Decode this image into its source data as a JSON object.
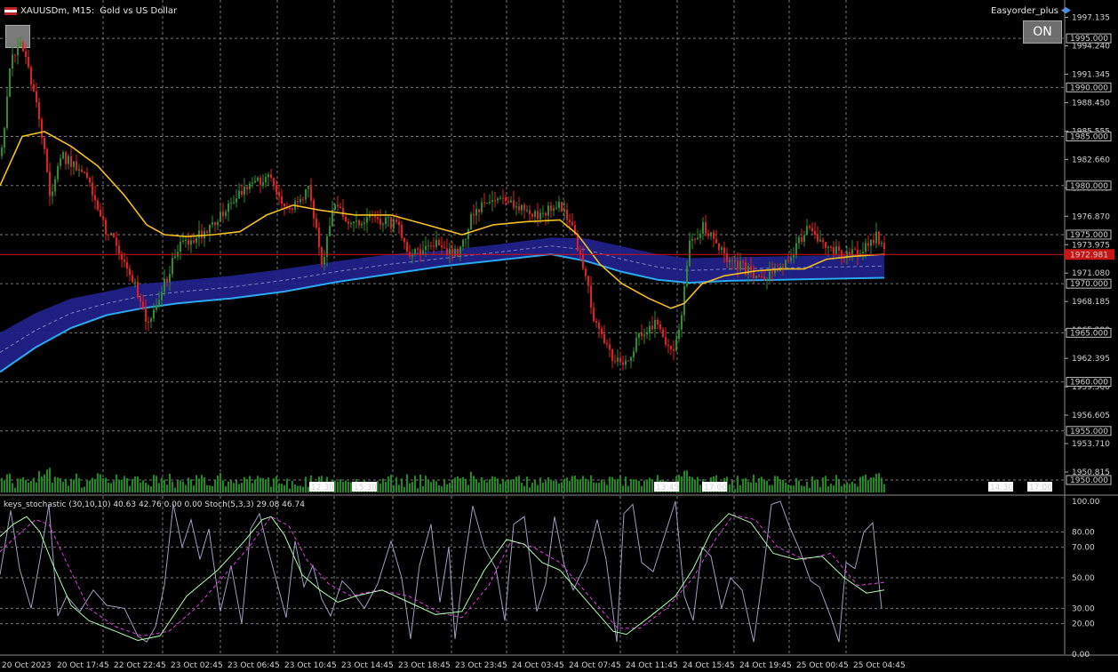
{
  "header": {
    "symbol": "XAUUSDm, M15:",
    "description": "Gold vs US Dollar"
  },
  "expert": {
    "name": "Easyorder_plus"
  },
  "buttons": {
    "on_label": "ON"
  },
  "indicator": {
    "label": "keys_stochastic (30,10,10) 40.63 42.76 0.00 0.00 Stoch(5,3,3) 29.08 46.74"
  },
  "colors": {
    "bull": "#2e8b2e",
    "bear": "#e31e1e",
    "ema_line": "#f2c01e",
    "band_fill": "#222290",
    "band_edge": "#2aa8f2",
    "hline": "#c81414",
    "grid": "#777777",
    "stoch_main": "#b0ffb0",
    "stoch_signal": "#e040e0",
    "stoch_fast": "#9aa0c0"
  },
  "chart_data": {
    "type": "candlestick",
    "title": "XAUUSDm, M15: Gold vs US Dollar",
    "price_axis": {
      "ylim": [
        1950.0,
        1998.0
      ],
      "tick_labels": [
        "1997.135",
        "1994.240",
        "1991.345",
        "1988.450",
        "1985.555",
        "1982.660",
        "1979.765",
        "1976.870",
        "1973.975",
        "1971.080",
        "1968.185",
        "1965.290",
        "1962.395",
        "1959.500",
        "1956.605",
        "1953.710",
        "1950.815"
      ],
      "boxed_levels": [
        "1995.000",
        "1990.000",
        "1985.000",
        "1980.000",
        "1975.000",
        "1970.000",
        "1965.000",
        "1960.000",
        "1955.000",
        "1950.000"
      ],
      "current_price": "1972.981"
    },
    "stochastic_axis": {
      "ylim": [
        0,
        100
      ],
      "tick_labels": [
        "100.00",
        "80.00",
        "70.00",
        "50.00",
        "30.00",
        "20.00",
        "0.00"
      ]
    },
    "time_labels": [
      "20 Oct 2023",
      "20 Oct 17:45",
      "22 Oct 22:45",
      "23 Oct 02:45",
      "23 Oct 06:45",
      "23 Oct 10:45",
      "23 Oct 14:45",
      "23 Oct 18:45",
      "23 Oct 23:45",
      "24 Oct 03:45",
      "24 Oct 07:45",
      "24 Oct 11:45",
      "24 Oct 15:45",
      "24 Oct 19:45",
      "25 Oct 00:45",
      "25 Oct 04:45"
    ],
    "time_tags": [
      "12:30",
      "15:30",
      "13:45",
      "17:00",
      "14:30",
      "17:00"
    ],
    "close_path": [
      [
        0,
        1983
      ],
      [
        12,
        1993
      ],
      [
        22,
        1995
      ],
      [
        30,
        1992
      ],
      [
        45,
        1986
      ],
      [
        55,
        1979
      ],
      [
        70,
        1983
      ],
      [
        95,
        1981
      ],
      [
        115,
        1976
      ],
      [
        135,
        1973
      ],
      [
        150,
        1970
      ],
      [
        165,
        1966
      ],
      [
        180,
        1969
      ],
      [
        200,
        1974
      ],
      [
        225,
        1975
      ],
      [
        250,
        1977
      ],
      [
        275,
        1980
      ],
      [
        300,
        1981
      ],
      [
        315,
        1978
      ],
      [
        335,
        1978
      ],
      [
        345,
        1980
      ],
      [
        362,
        1972
      ],
      [
        375,
        1978
      ],
      [
        395,
        1976
      ],
      [
        415,
        1977
      ],
      [
        445,
        1976
      ],
      [
        460,
        1973
      ],
      [
        490,
        1974
      ],
      [
        515,
        1973
      ],
      [
        530,
        1977
      ],
      [
        555,
        1979
      ],
      [
        575,
        1978
      ],
      [
        600,
        1977
      ],
      [
        630,
        1978
      ],
      [
        645,
        1975
      ],
      [
        655,
        1972
      ],
      [
        668,
        1966
      ],
      [
        690,
        1962
      ],
      [
        705,
        1962
      ],
      [
        718,
        1965
      ],
      [
        735,
        1966
      ],
      [
        755,
        1963
      ],
      [
        765,
        1966
      ],
      [
        775,
        1974
      ],
      [
        790,
        1976
      ],
      [
        805,
        1974
      ],
      [
        825,
        1972
      ],
      [
        850,
        1971
      ],
      [
        875,
        1971
      ],
      [
        890,
        1973
      ],
      [
        910,
        1976
      ],
      [
        925,
        1974
      ],
      [
        945,
        1973
      ],
      [
        965,
        1973
      ],
      [
        985,
        1975
      ],
      [
        995,
        1973
      ]
    ],
    "ema_path": [
      [
        0,
        1980
      ],
      [
        25,
        1985
      ],
      [
        50,
        1985.5
      ],
      [
        80,
        1984
      ],
      [
        110,
        1982
      ],
      [
        140,
        1979
      ],
      [
        165,
        1976
      ],
      [
        185,
        1975
      ],
      [
        210,
        1974.8
      ],
      [
        240,
        1975
      ],
      [
        270,
        1975.3
      ],
      [
        300,
        1977
      ],
      [
        330,
        1978
      ],
      [
        360,
        1977.5
      ],
      [
        400,
        1977
      ],
      [
        440,
        1977
      ],
      [
        480,
        1976
      ],
      [
        520,
        1975
      ],
      [
        555,
        1976
      ],
      [
        590,
        1976.3
      ],
      [
        630,
        1976.5
      ],
      [
        650,
        1975
      ],
      [
        675,
        1972
      ],
      [
        700,
        1970
      ],
      [
        730,
        1968.5
      ],
      [
        755,
        1967.5
      ],
      [
        770,
        1968
      ],
      [
        790,
        1970
      ],
      [
        815,
        1970.8
      ],
      [
        850,
        1971.3
      ],
      [
        880,
        1971.5
      ],
      [
        905,
        1971.5
      ],
      [
        930,
        1972.5
      ],
      [
        960,
        1972.8
      ],
      [
        995,
        1973
      ]
    ],
    "band_upper": [
      [
        0,
        1965
      ],
      [
        40,
        1967
      ],
      [
        80,
        1968.5
      ],
      [
        120,
        1969.2
      ],
      [
        160,
        1970
      ],
      [
        200,
        1970.3
      ],
      [
        260,
        1970.8
      ],
      [
        320,
        1971.5
      ],
      [
        380,
        1972.3
      ],
      [
        440,
        1973
      ],
      [
        500,
        1973.4
      ],
      [
        560,
        1974
      ],
      [
        620,
        1974.7
      ],
      [
        660,
        1974.6
      ],
      [
        700,
        1973.8
      ],
      [
        740,
        1973
      ],
      [
        775,
        1972.6
      ],
      [
        820,
        1972.7
      ],
      [
        880,
        1972.8
      ],
      [
        995,
        1973
      ]
    ],
    "band_lower": [
      [
        0,
        1961
      ],
      [
        40,
        1963.5
      ],
      [
        80,
        1965.5
      ],
      [
        120,
        1966.8
      ],
      [
        160,
        1967.5
      ],
      [
        200,
        1968
      ],
      [
        260,
        1968.5
      ],
      [
        320,
        1969.2
      ],
      [
        380,
        1970.2
      ],
      [
        440,
        1971
      ],
      [
        500,
        1971.8
      ],
      [
        560,
        1972.4
      ],
      [
        620,
        1973
      ],
      [
        660,
        1972.3
      ],
      [
        700,
        1971.2
      ],
      [
        740,
        1970.4
      ],
      [
        775,
        1970.1
      ],
      [
        820,
        1970.3
      ],
      [
        880,
        1970.4
      ],
      [
        995,
        1970.6
      ]
    ],
    "stoch_main": [
      [
        0,
        77
      ],
      [
        15,
        85
      ],
      [
        30,
        90
      ],
      [
        45,
        80
      ],
      [
        60,
        58
      ],
      [
        80,
        32
      ],
      [
        100,
        22
      ],
      [
        130,
        15
      ],
      [
        155,
        9
      ],
      [
        180,
        12
      ],
      [
        210,
        38
      ],
      [
        245,
        55
      ],
      [
        275,
        74
      ],
      [
        295,
        88
      ],
      [
        305,
        90
      ],
      [
        320,
        78
      ],
      [
        340,
        52
      ],
      [
        360,
        42
      ],
      [
        380,
        34
      ],
      [
        400,
        38
      ],
      [
        430,
        42
      ],
      [
        460,
        34
      ],
      [
        490,
        26
      ],
      [
        520,
        28
      ],
      [
        545,
        55
      ],
      [
        570,
        75
      ],
      [
        590,
        72
      ],
      [
        610,
        60
      ],
      [
        630,
        55
      ],
      [
        660,
        35
      ],
      [
        690,
        15
      ],
      [
        705,
        13
      ],
      [
        730,
        24
      ],
      [
        760,
        38
      ],
      [
        780,
        56
      ],
      [
        800,
        80
      ],
      [
        820,
        92
      ],
      [
        845,
        86
      ],
      [
        870,
        66
      ],
      [
        895,
        62
      ],
      [
        925,
        64
      ],
      [
        950,
        50
      ],
      [
        975,
        40
      ],
      [
        995,
        42
      ]
    ],
    "stoch_signal": [
      [
        0,
        67
      ],
      [
        20,
        78
      ],
      [
        40,
        88
      ],
      [
        55,
        85
      ],
      [
        75,
        60
      ],
      [
        100,
        30
      ],
      [
        130,
        18
      ],
      [
        160,
        12
      ],
      [
        190,
        15
      ],
      [
        220,
        30
      ],
      [
        250,
        50
      ],
      [
        280,
        70
      ],
      [
        305,
        90
      ],
      [
        325,
        84
      ],
      [
        345,
        62
      ],
      [
        370,
        46
      ],
      [
        395,
        38
      ],
      [
        425,
        42
      ],
      [
        460,
        38
      ],
      [
        495,
        27
      ],
      [
        520,
        24
      ],
      [
        550,
        45
      ],
      [
        575,
        74
      ],
      [
        600,
        70
      ],
      [
        630,
        60
      ],
      [
        660,
        40
      ],
      [
        695,
        17
      ],
      [
        720,
        17
      ],
      [
        750,
        30
      ],
      [
        780,
        50
      ],
      [
        805,
        75
      ],
      [
        825,
        91
      ],
      [
        850,
        88
      ],
      [
        875,
        70
      ],
      [
        905,
        62
      ],
      [
        935,
        66
      ],
      [
        965,
        45
      ],
      [
        995,
        47
      ]
    ],
    "stoch_fast": [
      [
        0,
        52
      ],
      [
        12,
        94
      ],
      [
        22,
        56
      ],
      [
        35,
        30
      ],
      [
        45,
        62
      ],
      [
        55,
        98
      ],
      [
        65,
        25
      ],
      [
        75,
        38
      ],
      [
        90,
        28
      ],
      [
        105,
        42
      ],
      [
        120,
        32
      ],
      [
        140,
        30
      ],
      [
        155,
        12
      ],
      [
        165,
        8
      ],
      [
        175,
        18
      ],
      [
        185,
        45
      ],
      [
        195,
        98
      ],
      [
        205,
        70
      ],
      [
        215,
        88
      ],
      [
        225,
        62
      ],
      [
        235,
        82
      ],
      [
        248,
        28
      ],
      [
        260,
        58
      ],
      [
        272,
        20
      ],
      [
        282,
        82
      ],
      [
        292,
        92
      ],
      [
        300,
        72
      ],
      [
        312,
        46
      ],
      [
        322,
        24
      ],
      [
        332,
        74
      ],
      [
        342,
        44
      ],
      [
        352,
        58
      ],
      [
        362,
        36
      ],
      [
        372,
        25
      ],
      [
        385,
        48
      ],
      [
        395,
        42
      ],
      [
        410,
        30
      ],
      [
        425,
        46
      ],
      [
        440,
        74
      ],
      [
        452,
        50
      ],
      [
        462,
        10
      ],
      [
        472,
        58
      ],
      [
        485,
        85
      ],
      [
        495,
        34
      ],
      [
        505,
        70
      ],
      [
        512,
        10
      ],
      [
        522,
        58
      ],
      [
        532,
        97
      ],
      [
        545,
        70
      ],
      [
        558,
        56
      ],
      [
        568,
        22
      ],
      [
        578,
        85
      ],
      [
        590,
        90
      ],
      [
        604,
        28
      ],
      [
        614,
        46
      ],
      [
        624,
        90
      ],
      [
        635,
        58
      ],
      [
        645,
        42
      ],
      [
        660,
        60
      ],
      [
        672,
        88
      ],
      [
        682,
        62
      ],
      [
        694,
        8
      ],
      [
        702,
        92
      ],
      [
        712,
        98
      ],
      [
        722,
        60
      ],
      [
        735,
        54
      ],
      [
        748,
        78
      ],
      [
        760,
        100
      ],
      [
        770,
        38
      ],
      [
        780,
        22
      ],
      [
        790,
        70
      ],
      [
        800,
        64
      ],
      [
        812,
        30
      ],
      [
        822,
        50
      ],
      [
        835,
        42
      ],
      [
        848,
        8
      ],
      [
        858,
        50
      ],
      [
        868,
        98
      ],
      [
        878,
        100
      ],
      [
        888,
        84
      ],
      [
        900,
        68
      ],
      [
        912,
        48
      ],
      [
        922,
        44
      ],
      [
        935,
        24
      ],
      [
        944,
        8
      ],
      [
        952,
        60
      ],
      [
        962,
        56
      ],
      [
        972,
        80
      ],
      [
        982,
        86
      ],
      [
        992,
        30
      ]
    ],
    "candles_seed": 20231020
  }
}
